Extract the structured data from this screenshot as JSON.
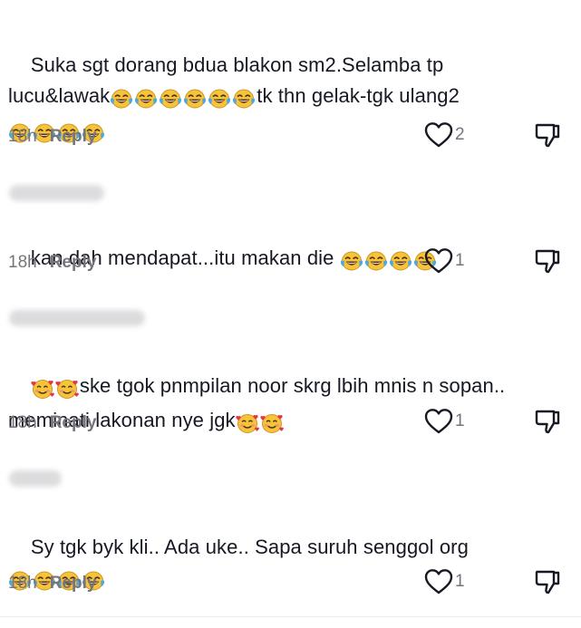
{
  "comments": [
    {
      "text_parts": [
        "Suka sgt dorang bdua blakon sm2.Selamba tp lucu&lawak",
        "tk thn gelak-tgk ulang2 "
      ],
      "time": "18h",
      "reply_label": "Reply",
      "likes": "2"
    },
    {
      "text_parts": [
        "kan dah mendapat...itu makan die "
      ],
      "time": "18h",
      "reply_label": "Reply",
      "likes": "1"
    },
    {
      "text_parts": [
        "ske tgok pnmpilan noor skrg lbih mnis n sopan.. meminati lakonan nye jgk"
      ],
      "time": "18h",
      "reply_label": "Reply",
      "likes": "1"
    },
    {
      "text_parts": [
        "Sy tgk byk kli.. Ada uke.. Sapa suruh senggol org"
      ],
      "time": "18h",
      "reply_label": "Reply",
      "likes": "1"
    }
  ],
  "icons": {
    "like": "heart-outline-icon",
    "dislike": "thumbs-down-icon",
    "emoji_laugh": "face-with-tears-of-joy-emoji",
    "emoji_love": "smiling-face-with-hearts-emoji"
  },
  "colors": {
    "text": "#161823",
    "secondary": "#75767c",
    "emoji_face": "#f7c337"
  }
}
